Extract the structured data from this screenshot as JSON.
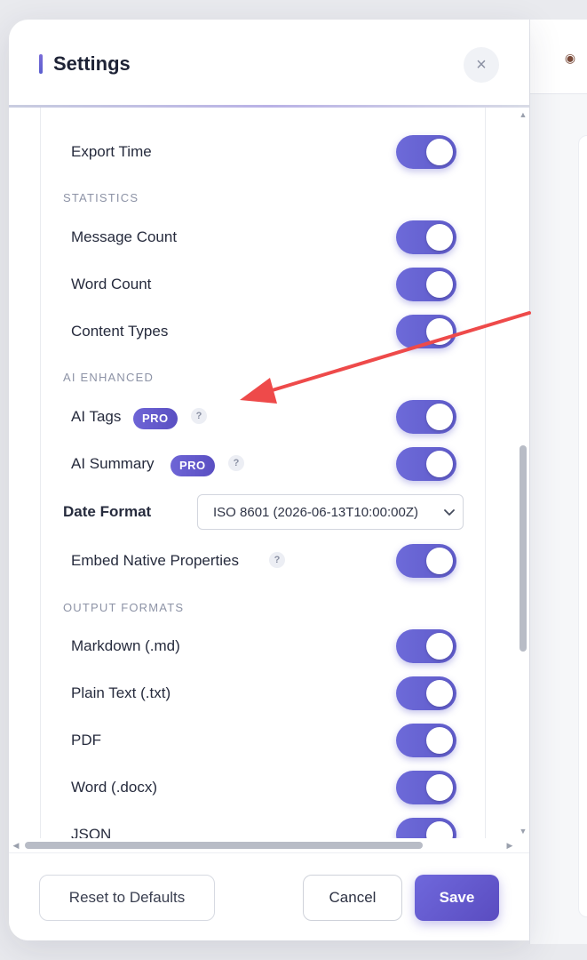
{
  "modal": {
    "title": "Settings",
    "close_label": "×"
  },
  "settings": {
    "export_time": {
      "label": "Export Time",
      "enabled": true
    },
    "statistics_header": "STATISTICS",
    "message_count": {
      "label": "Message Count",
      "enabled": true
    },
    "word_count": {
      "label": "Word Count",
      "enabled": true
    },
    "content_types": {
      "label": "Content Types",
      "enabled": true
    },
    "ai_header": "AI ENHANCED",
    "ai_tags": {
      "label": "AI Tags",
      "badge": "PRO",
      "help": "?",
      "enabled": true
    },
    "ai_summary": {
      "label": "AI Summary",
      "badge": "PRO",
      "help": "?",
      "enabled": true
    },
    "date_format": {
      "label": "Date Format",
      "value": "ISO 8601 (2026-06-13T10:00:00Z)"
    },
    "embed_native": {
      "label": "Embed Native Properties",
      "help": "?",
      "enabled": true
    },
    "output_header": "OUTPUT FORMATS",
    "markdown": {
      "label": "Markdown (.md)",
      "enabled": true
    },
    "plain_text": {
      "label": "Plain Text (.txt)",
      "enabled": true
    },
    "pdf": {
      "label": "PDF",
      "enabled": true
    },
    "word": {
      "label": "Word (.docx)",
      "enabled": true
    },
    "json": {
      "label": "JSON",
      "enabled": true
    }
  },
  "footer": {
    "reset_label": "Reset to Defaults",
    "cancel_label": "Cancel",
    "save_label": "Save"
  },
  "colors": {
    "accent": "#6360d2",
    "annotation": "#ee4a4a"
  }
}
